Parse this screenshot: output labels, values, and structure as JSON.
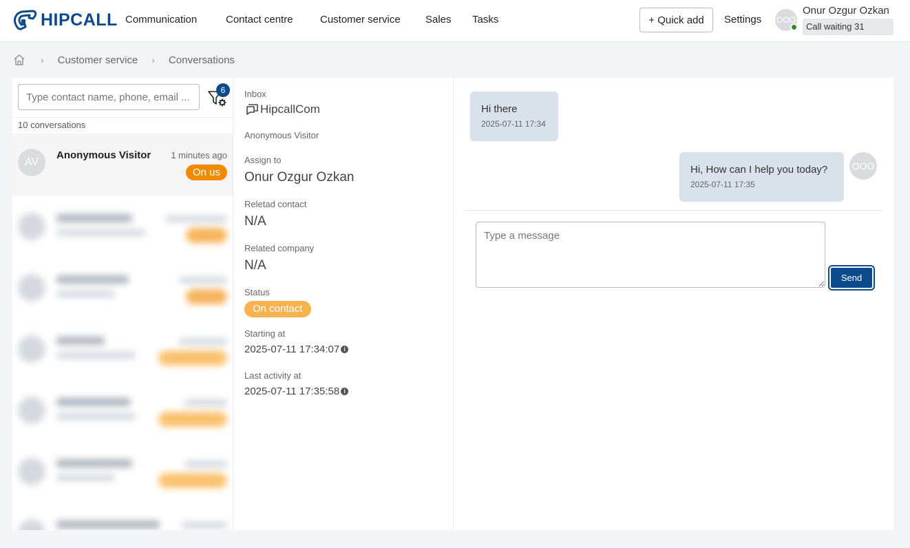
{
  "brand": {
    "name": "HIPCALL"
  },
  "nav": {
    "items": [
      "Communication",
      "Contact centre",
      "Customer service",
      "Sales",
      "Tasks"
    ]
  },
  "header": {
    "quick_add_label": "+ Quick add",
    "settings_label": "Settings",
    "user_initials": "OOO",
    "user_name": "Onur Ozgur Ozkan",
    "call_waiting": "Call waiting 31"
  },
  "breadcrumb": {
    "items": [
      "Customer service",
      "Conversations"
    ]
  },
  "conversations": {
    "search_placeholder": "Type contact name, phone, email ...",
    "filter_count": "6",
    "count_label": "10 conversations",
    "active": {
      "initials": "AV",
      "name": "Anonymous Visitor",
      "time": "1 minutes ago",
      "badge": "On us"
    }
  },
  "details": {
    "inbox_label": "Inbox",
    "inbox_value": "HipcallCom",
    "visitor": "Anonymous Visitor",
    "assign_label": "Assign to",
    "assign_value": "Onur Ozgur Ozkan",
    "contact_label": "Reletad contact",
    "contact_value": "N/A",
    "company_label": "Related company",
    "company_value": "N/A",
    "status_label": "Status",
    "status_value": "On contact",
    "start_label": "Starting at",
    "start_value": "2025-07-11 17:34:07",
    "last_label": "Last activity at",
    "last_value": "2025-07-11 17:35:58"
  },
  "chat": {
    "messages": [
      {
        "text": "Hi there",
        "time": "2025-07-11 17:34",
        "direction": "in"
      },
      {
        "text": "Hi, How can I help you today?",
        "time": "2025-07-11 17:35",
        "direction": "out"
      }
    ],
    "agent_initials": "OOO",
    "input_placeholder": "Type a message",
    "send_label": "Send"
  },
  "colors": {
    "brand": "#0b4a8b",
    "badge_orange": "#f08a00",
    "status_orange": "#f8b24f",
    "online_green": "#2e8b2e"
  }
}
